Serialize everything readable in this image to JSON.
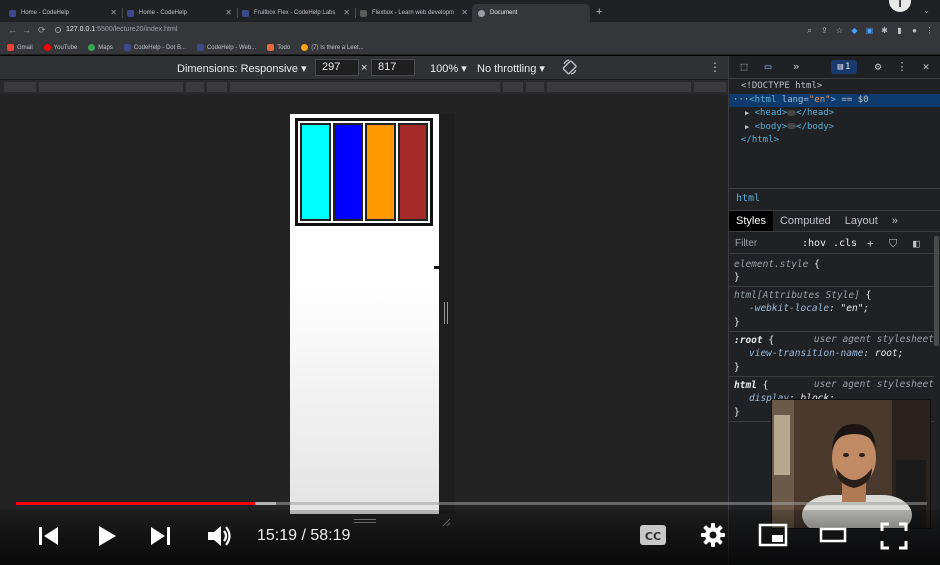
{
  "browser": {
    "tabs": [
      {
        "label": "Home - CodeHelp",
        "active": false
      },
      {
        "label": "Home - CodeHelp",
        "active": false
      },
      {
        "label": "Fruitbox Flex - CodeHelp Labs",
        "active": false
      },
      {
        "label": "Flexbox - Learn web developm",
        "active": false
      },
      {
        "label": "Document",
        "active": true
      }
    ],
    "url_host": "127.0.0.1",
    "url_port": ":5500",
    "url_path": "/lecture20/index.html",
    "bookmarks": [
      "Gmail",
      "YouTube",
      "Maps",
      "CodeHelp - Dot B...",
      "CodeHelp - Web...",
      "Todo",
      "(7) Is there a Leet..."
    ]
  },
  "device_toolbar": {
    "dimensions_label": "Dimensions: Responsive",
    "width": "297",
    "times": "×",
    "height": "817",
    "zoom": "100%",
    "throttling": "No throttling"
  },
  "page": {
    "box_colors": [
      "#00ffff",
      "#0000ff",
      "#ff9900",
      "#a52a2a"
    ]
  },
  "devtools": {
    "issues_count": "1",
    "dom": {
      "doctype": "<!DOCTYPE html>",
      "html_open_tag": "<html",
      "html_attr_name": " lang=",
      "html_attr_value": "\"en\"",
      "html_close_bracket": ">",
      "selected_marker": " == $0",
      "head_open": "<head>",
      "head_close": "</head>",
      "body_open": "<body>",
      "body_close": "</body>",
      "html_close": "</html>"
    },
    "breadcrumb": "html",
    "tabs": [
      "Styles",
      "Computed",
      "Layout"
    ],
    "filter_placeholder": "Filter",
    "hov": ":hov",
    "cls": ".cls",
    "rules": {
      "element_style_selector": "element.style",
      "attr_style_selector": "html[Attributes Style]",
      "attr_style_prop": "-webkit-locale",
      "attr_style_val": "\"en\"",
      "root_selector": ":root",
      "root_origin": "user agent stylesheet",
      "root_prop": "view-transition-name",
      "root_val": "root",
      "html_selector": "html",
      "html_origin": "user agent stylesheet",
      "html_prop": "display",
      "html_val": "block"
    }
  },
  "player": {
    "current_time": "15:19",
    "duration": "58:19",
    "time_display": "15:19 / 58:19",
    "played_fraction": 0.2626,
    "buffered_fraction": 0.285,
    "accent": "#ff0000"
  }
}
